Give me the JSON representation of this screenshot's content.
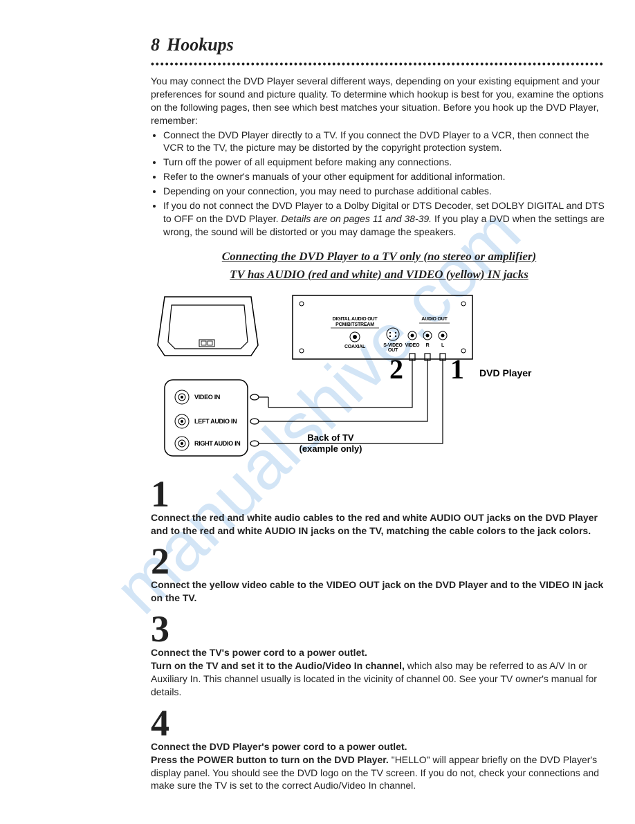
{
  "pageNumber": "8",
  "pageTitle": "Hookups",
  "dottedRule": "•••••••••••••••••••••••••••••••••••••••••••••••••••••••••••••••••••••••••••••••••••••••••••••••",
  "intro": "You may connect the DVD Player several different ways, depending on your existing equipment and your preferences for sound and picture quality. To determine which hookup is best for you, examine the options on the following pages, then see which best matches your situation. Before you hook up the DVD Player, remember:",
  "bullets": [
    "Connect the DVD Player directly to a TV. If you connect the DVD Player to a VCR, then connect the VCR to the TV, the picture may be distorted by the copyright protection system.",
    "Turn off the power of all equipment before making any connections.",
    "Refer to the owner's manuals of your other equipment for additional information.",
    "Depending on your connection, you may need to purchase additional cables."
  ],
  "bullet5_pre": "If you do not connect the DVD Player to a Dolby Digital or DTS Decoder, set DOLBY DIGITAL and DTS to OFF on the DVD Player. ",
  "bullet5_italic": "Details are on pages 11 and 38-39.",
  "bullet5_post": " If you play a DVD when the settings are wrong, the sound will be distorted or you may damage the speakers.",
  "subheading1": "Connecting the DVD Player to a TV only (no stereo or amplifier)",
  "subheading2": "TV has AUDIO (red and white) and VIDEO (yellow) IN jacks",
  "diagram": {
    "dvdPlayerLabel": "DVD Player",
    "backOfTv1": "Back of TV",
    "backOfTv2": "(example only)",
    "videoIn": "VIDEO IN",
    "leftAudioIn": "LEFT AUDIO IN",
    "rightAudioIn": "RIGHT AUDIO IN",
    "digitalAudioOut1": "DIGITAL AUDIO OUT",
    "digitalAudioOut2": "PCM/BITSTREAM",
    "coaxial": "COAXIAL",
    "svideoOut": "S-VIDEO",
    "svideoOut2": "OUT",
    "audioOut": "AUDIO OUT",
    "video": "VIDEO",
    "r": "R",
    "l": "L",
    "num1": "1",
    "num2": "2"
  },
  "steps": {
    "s1num": "1",
    "s1": "Connect the red and white audio cables to the red and white AUDIO OUT jacks on the DVD Player and to the red and white AUDIO IN jacks on the TV, matching the cable colors to the jack colors.",
    "s2num": "2",
    "s2": "Connect the yellow video cable to the VIDEO OUT jack on the DVD Player and to the VIDEO IN jack on the TV.",
    "s3num": "3",
    "s3a": "Connect the TV's power cord to a power outlet.",
    "s3b": "Turn on the TV and set it to the Audio/Video In channel,",
    "s3b_rest": " which also may be referred to as A/V In or Auxiliary In. This channel usually is located in the vicinity of channel 00. See your TV owner's manual for details.",
    "s4num": "4",
    "s4a": "Connect the DVD Player's power cord to a power outlet.",
    "s4b": "Press the POWER button to turn on the DVD Player.",
    "s4b_rest": " \"HELLO\" will appear briefly on the DVD Player's display panel. You should see the DVD logo on the TV screen. If you do not, check your connections and make sure the TV is set to the correct Audio/Video In channel."
  },
  "watermark": "manualshive.com"
}
